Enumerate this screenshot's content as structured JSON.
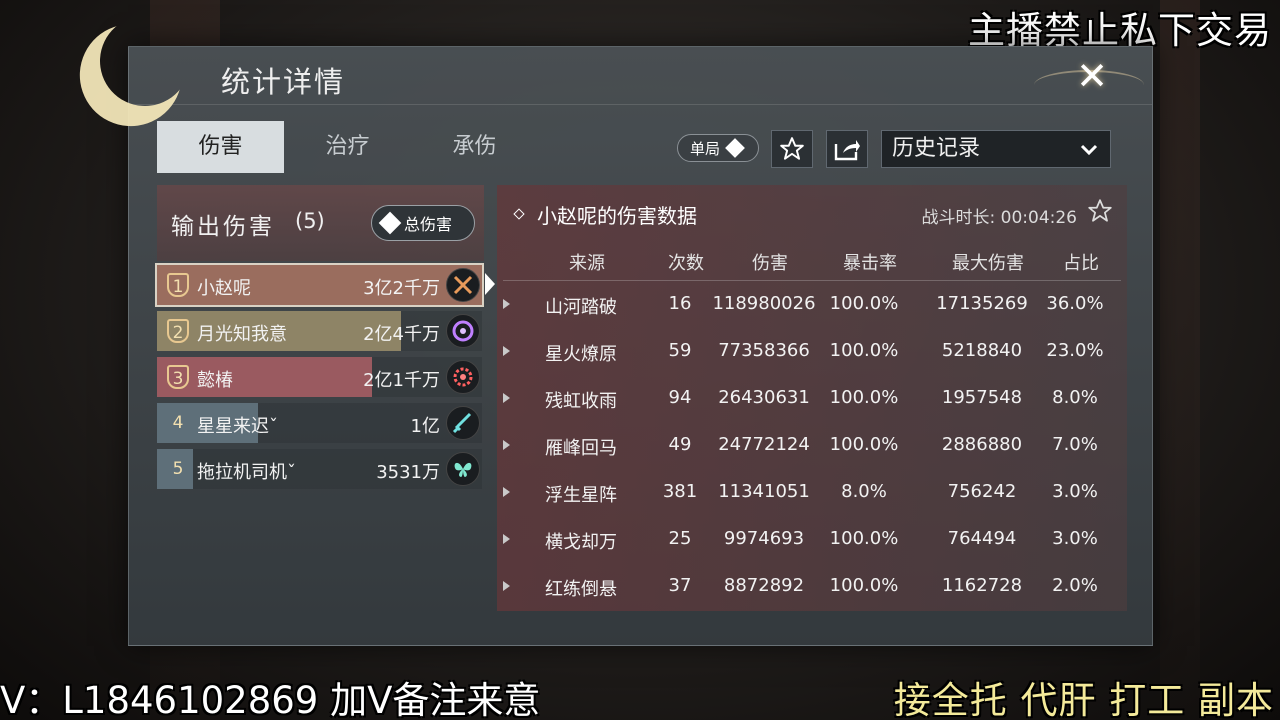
{
  "overlays": {
    "top_right": "主播禁止私下交易",
    "bottom_left": "V：L1846102869 加V备注来意",
    "bottom_right": "接全托 代肝 打工 副本"
  },
  "window": {
    "title": "统计详情",
    "close_label": "✕"
  },
  "tabs": [
    {
      "label": "伤害",
      "active": true
    },
    {
      "label": "治疗",
      "active": false
    },
    {
      "label": "承伤",
      "active": false
    }
  ],
  "toolbar": {
    "mode_label": "单局",
    "history_label": "历史记录"
  },
  "left_panel": {
    "title": "输出伤害",
    "count": "(5)",
    "total_button": "总伤害",
    "players": [
      {
        "rank": "1",
        "name": "小赵呢",
        "value": "3亿2千万",
        "icon": "crossed-swords-icon",
        "fill": 1.0,
        "color": "#9a6d5e",
        "selected": true
      },
      {
        "rank": "2",
        "name": "月光知我意",
        "value": "2亿4千万",
        "icon": "moon-target-icon",
        "fill": 0.75,
        "color": "#8e8466",
        "selected": false
      },
      {
        "rank": "3",
        "name": "懿椿",
        "value": "2亿1千万",
        "icon": "lotus-icon",
        "fill": 0.66,
        "color": "#9a5a60",
        "selected": false
      },
      {
        "rank": "4",
        "name": "星星来迟ˇ",
        "value": "1亿",
        "icon": "sword-icon",
        "fill": 0.31,
        "color": "#5e6f79",
        "selected": false
      },
      {
        "rank": "5",
        "name": "拖拉机司机ˇ",
        "value": "3531万",
        "icon": "butterfly-icon",
        "fill": 0.11,
        "color": "#5e6f79",
        "selected": false
      }
    ]
  },
  "detail": {
    "title": "小赵呢的伤害数据",
    "duration_label": "战斗时长: 00:04:26",
    "columns": [
      "来源",
      "次数",
      "伤害",
      "暴击率",
      "最大伤害",
      "占比"
    ],
    "rows": [
      [
        "山河踏破",
        "16",
        "118980026",
        "100.0%",
        "17135269",
        "36.0%"
      ],
      [
        "星火燎原",
        "59",
        "77358366",
        "100.0%",
        "5218840",
        "23.0%"
      ],
      [
        "残虹收雨",
        "94",
        "26430631",
        "100.0%",
        "1957548",
        "8.0%"
      ],
      [
        "雁峰回马",
        "49",
        "24772124",
        "100.0%",
        "2886880",
        "7.0%"
      ],
      [
        "浮生星阵",
        "381",
        "11341051",
        "8.0%",
        "756242",
        "3.0%"
      ],
      [
        "横戈却万",
        "25",
        "9974693",
        "100.0%",
        "764494",
        "3.0%"
      ],
      [
        "红练倒悬",
        "37",
        "8872892",
        "100.0%",
        "1162728",
        "2.0%"
      ]
    ]
  }
}
